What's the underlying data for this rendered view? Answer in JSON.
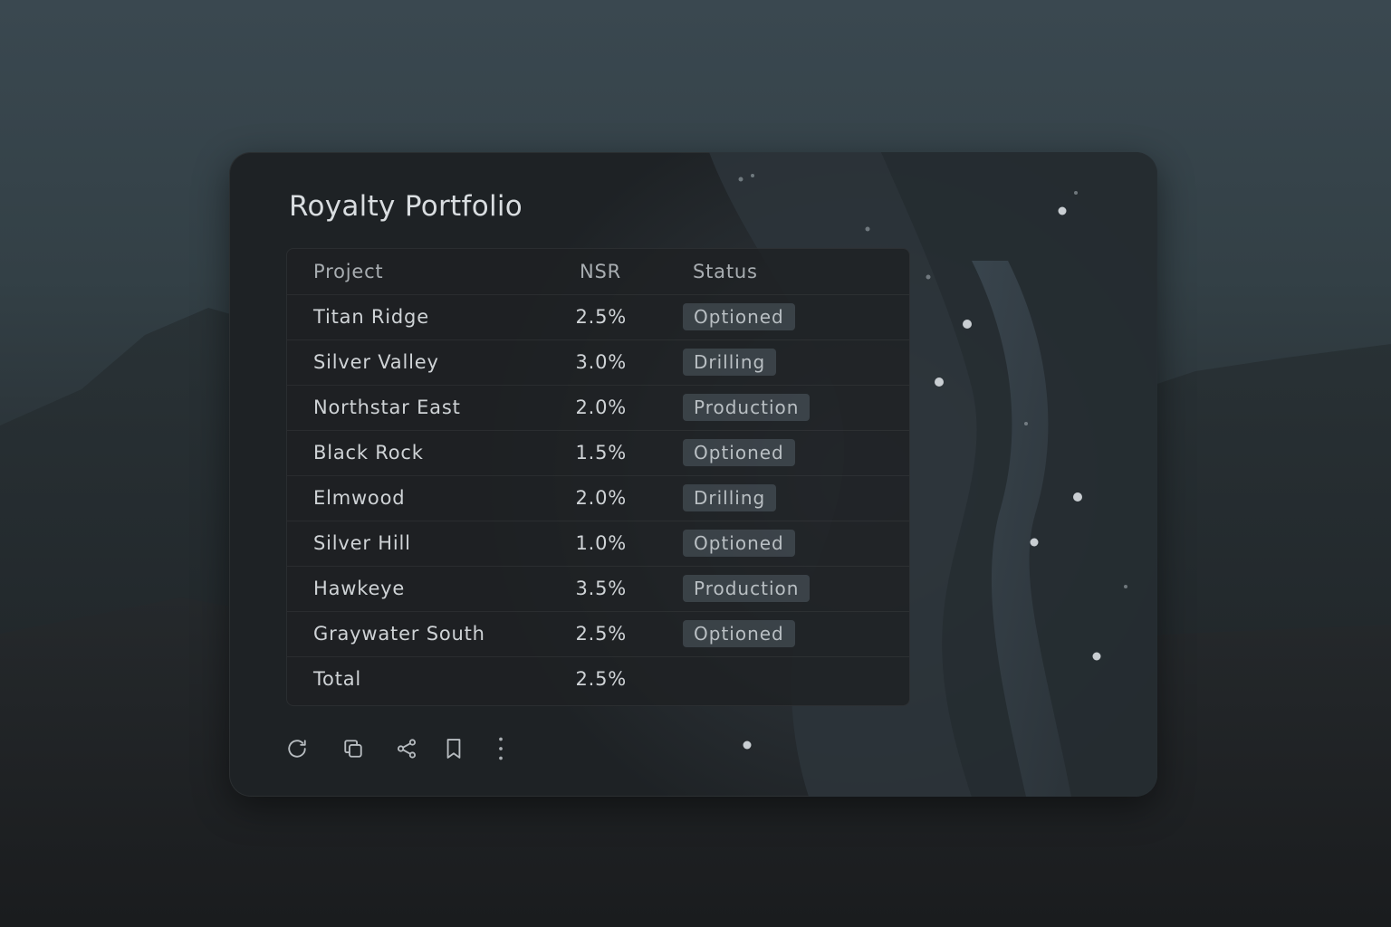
{
  "window": {
    "title": "Royalty Portfolio"
  },
  "table": {
    "headers": [
      "Project",
      "NSR",
      "Status"
    ],
    "rows": [
      {
        "project": "Titan Ridge",
        "nsr": "2.5%",
        "status": "Optioned"
      },
      {
        "project": "Silver Valley",
        "nsr": "3.0%",
        "status": "Drilling"
      },
      {
        "project": "Northstar East",
        "nsr": "2.0%",
        "status": "Production"
      },
      {
        "project": "Black Rock",
        "nsr": "1.5%",
        "status": "Optioned"
      },
      {
        "project": "Elmwood",
        "nsr": "2.0%",
        "status": "Drilling"
      },
      {
        "project": "Silver Hill",
        "nsr": "1.0%",
        "status": "Optioned"
      },
      {
        "project": "Hawkeye",
        "nsr": "3.5%",
        "status": "Production"
      },
      {
        "project": "Graywater South",
        "nsr": "2.5%",
        "status": "Optioned"
      }
    ],
    "total": {
      "label": "Total",
      "nsr": "2.5%"
    }
  },
  "toolbar": {
    "icons": [
      "refresh-icon",
      "copy-icon",
      "share-icon",
      "bookmark-icon",
      "more-vertical-icon"
    ]
  },
  "colors": {
    "badge_background": "#4d5760",
    "text_primary": "#cfd3d6",
    "card_background": "#1e2225"
  }
}
